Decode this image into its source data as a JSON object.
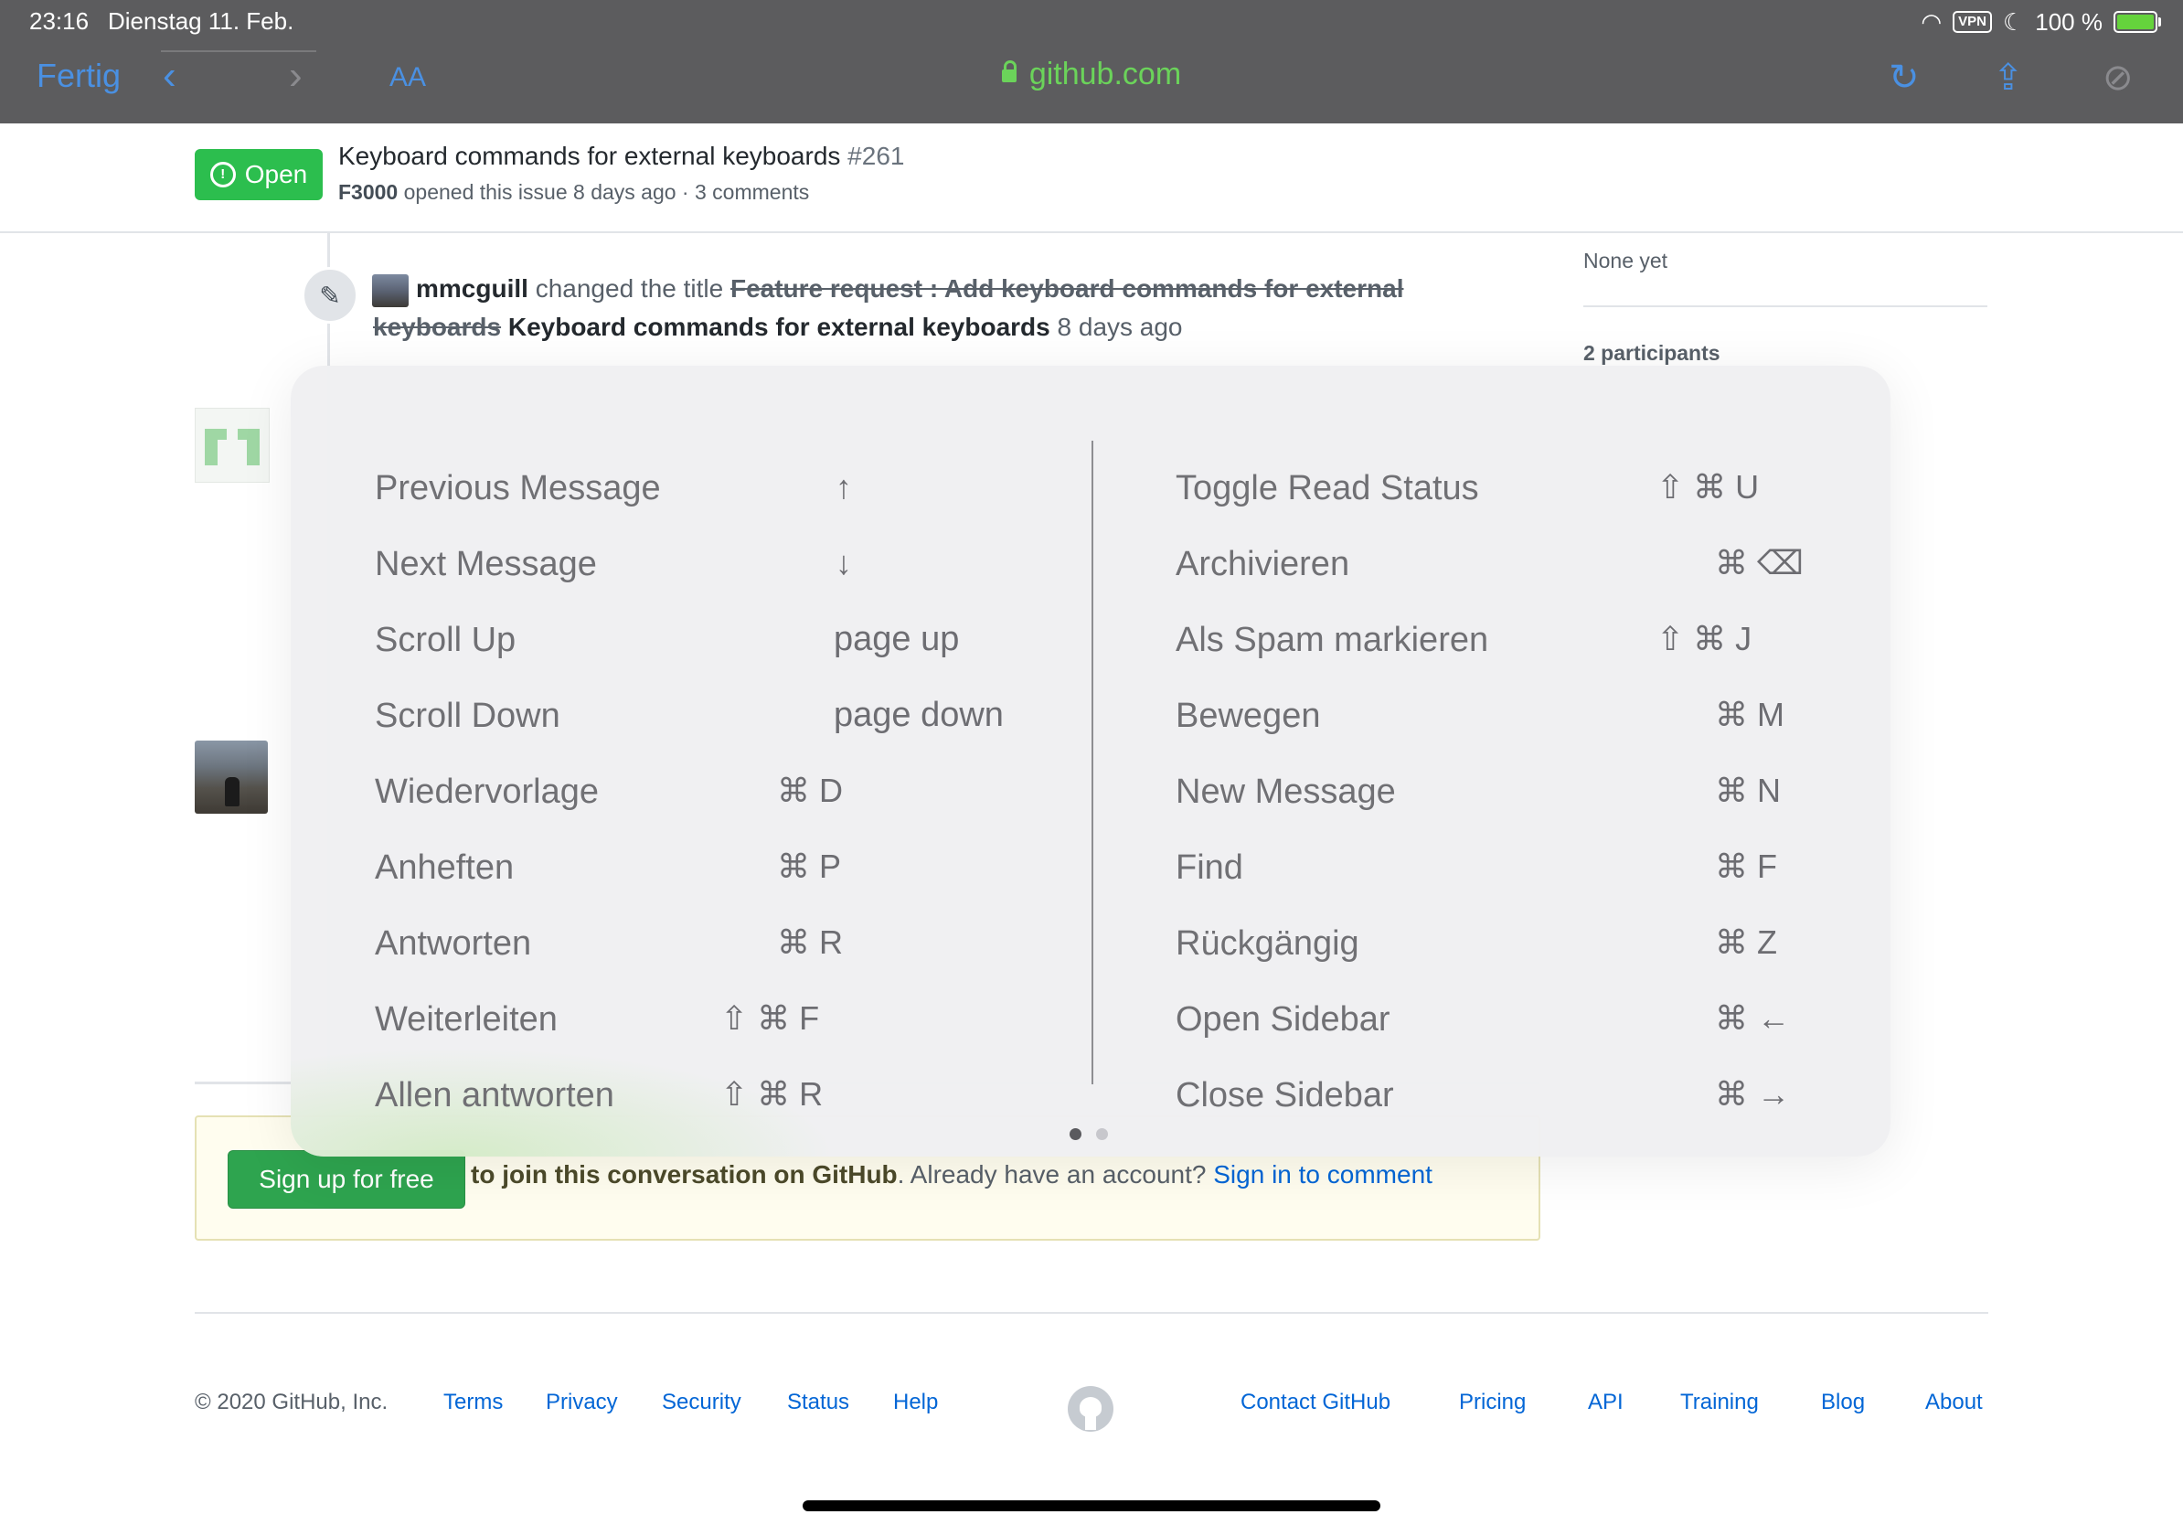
{
  "status_bar": {
    "time": "23:16",
    "date": "Dienstag 11. Feb.",
    "vpn": "VPN",
    "battery": "100 %"
  },
  "browser": {
    "done_label": "Fertig",
    "text_size_label": "AA",
    "url": "github.com"
  },
  "issue": {
    "status": "Open",
    "title": "Keyboard commands for external keyboards",
    "number": "#261",
    "author": "F3000",
    "meta": "opened this issue 8 days ago · 3 comments"
  },
  "timeline": {
    "actor": "mmcguill",
    "action": "changed the title",
    "old_title_part1": "Feature request : Add keyboard commands for external",
    "old_title_part2": "keyboards",
    "new_title": "Keyboard commands for external keyboards",
    "when": "8 days ago"
  },
  "sidebar": {
    "labels_value": "None yet",
    "participants": "2 participants"
  },
  "signup": {
    "button": "Sign up for free",
    "text_strong": "to join this conversation on GitHub",
    "text_rest": ". Already have an account?",
    "link": "Sign in to comment"
  },
  "footer": {
    "copyright": "© 2020 GitHub, Inc.",
    "left_links": [
      "Terms",
      "Privacy",
      "Security",
      "Status",
      "Help"
    ],
    "right_links": [
      "Contact GitHub",
      "Pricing",
      "API",
      "Training",
      "Blog",
      "About"
    ]
  },
  "shortcuts": {
    "left": [
      {
        "label": "Previous Message",
        "keys": "↑"
      },
      {
        "label": "Next Message",
        "keys": "↓"
      },
      {
        "label": "Scroll Up",
        "keys": "page up"
      },
      {
        "label": "Scroll Down",
        "keys": "page down"
      },
      {
        "label": "Wiedervorlage",
        "keys": "⌘ D"
      },
      {
        "label": "Anheften",
        "keys": "⌘ P"
      },
      {
        "label": "Antworten",
        "keys": "⌘ R"
      },
      {
        "label": "Weiterleiten",
        "keys": "⇧ ⌘ F"
      },
      {
        "label": "Allen antworten",
        "keys": "⇧ ⌘ R"
      }
    ],
    "right": [
      {
        "label": "Toggle Read Status",
        "keys": "⇧ ⌘ U"
      },
      {
        "label": "Archivieren",
        "keys": "⌘ ⌫"
      },
      {
        "label": "Als Spam markieren",
        "keys": "⇧ ⌘ J"
      },
      {
        "label": "Bewegen",
        "keys": "⌘ M"
      },
      {
        "label": "New Message",
        "keys": "⌘ N"
      },
      {
        "label": "Find",
        "keys": "⌘ F"
      },
      {
        "label": "Rückgängig",
        "keys": "⌘ Z"
      },
      {
        "label": "Open Sidebar",
        "keys": "⌘ ←"
      },
      {
        "label": "Close Sidebar",
        "keys": "⌘ →"
      }
    ]
  }
}
